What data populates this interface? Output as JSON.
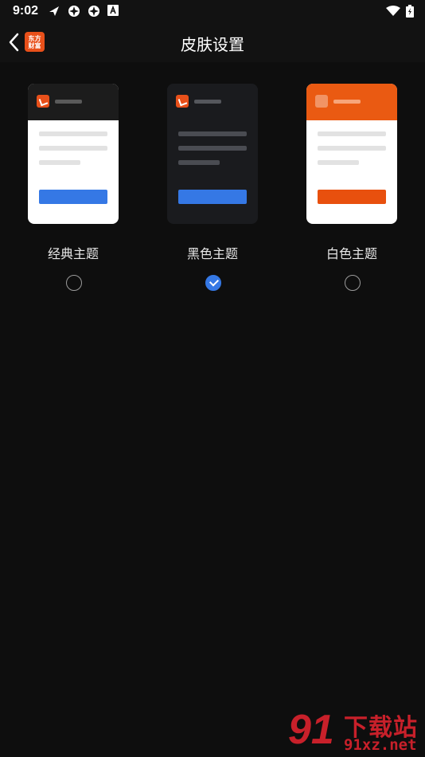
{
  "status_bar": {
    "time": "9:02",
    "left_icons": [
      "notification-paper-plane-icon",
      "aperture-icon",
      "aperture-icon",
      "a-box-icon"
    ],
    "right_icons": [
      "wifi-icon",
      "battery-icon"
    ]
  },
  "app_bar": {
    "back_icon": "chevron-left-icon",
    "logo_line1": "东方",
    "logo_line2": "财富",
    "title": "皮肤设置"
  },
  "themes": [
    {
      "label": "经典主题",
      "selected": false,
      "preview": {
        "header": "#1c1c1c",
        "body": "#ffffff",
        "lines": "#e2e2e2",
        "button": "#3578e5",
        "title_bar": "#5a5a5a"
      }
    },
    {
      "label": "黑色主题",
      "selected": true,
      "preview": {
        "header": "#1a1b1e",
        "body": "#1a1b1e",
        "lines": "#4a4c52",
        "button": "#3578e5",
        "title_bar": "#55575c"
      }
    },
    {
      "label": "白色主题",
      "selected": false,
      "preview": {
        "header": "#ea5a12",
        "body": "#ffffff",
        "lines": "#e2e2e2",
        "button": "#e8500e",
        "title_bar": "#f7a57a"
      }
    }
  ],
  "watermark": {
    "number": "91",
    "text": "下载站",
    "url": "91xz.net"
  },
  "colors": {
    "background": "#0e0e0e",
    "accent": "#3578e5",
    "brand": "#e8501a"
  }
}
